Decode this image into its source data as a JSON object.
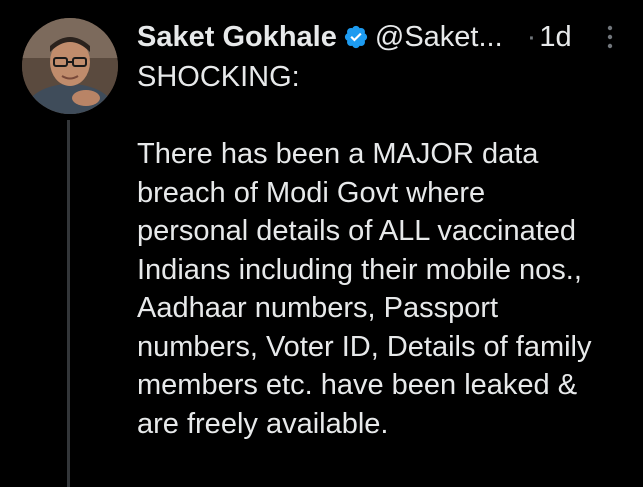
{
  "author": {
    "display_name": "Saket Gokhale",
    "handle": "@Saket...",
    "verified": true
  },
  "tweet": {
    "separator": "·",
    "timestamp": "1d",
    "headline": "SHOCKING:",
    "body_lines": [
      "There has been a MAJOR data",
      "breach of Modi Govt where",
      "personal details of ALL vaccinated",
      "Indians including their mobile nos.,",
      "Aadhaar numbers, Passport",
      "numbers, Voter ID, Details of family",
      "members etc. have been leaked &",
      "are freely available."
    ]
  },
  "colors": {
    "background": "#000000",
    "text": "#e7e9ea",
    "verified_badge": "#1d9bf0",
    "thread_line": "#333639"
  },
  "icons": {
    "verified": "verified-badge-icon",
    "more": "more-vertical-icon"
  }
}
